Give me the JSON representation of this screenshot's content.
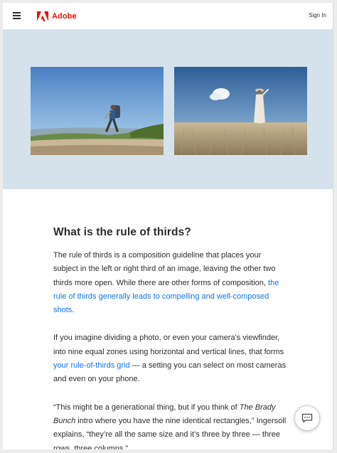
{
  "header": {
    "brand": "Adobe",
    "brand_color": "#eb1000",
    "menu_icon": "hamburger-menu-icon",
    "signin_label": "Sign In"
  },
  "hero": {
    "background": "#d5e2ec",
    "images": [
      {
        "name": "hiker-on-trail-photo"
      },
      {
        "name": "person-in-grass-field-photo"
      }
    ]
  },
  "article": {
    "heading": "What is the rule of thirds?",
    "p1_text": "The rule of thirds is a composition guideline that places your subject in the left or right third of an image, leaving the other two thirds more open. While there are other forms of composition, ",
    "p1_link": "the rule of thirds generally leads to compelling and well-composed shots",
    "p1_end": ".",
    "p2_text": "If you imagine dividing a photo, or even your camera's viewfinder, into nine equal zones using horizontal and vertical lines, that forms ",
    "p2_link": "your rule-of-thirds grid",
    "p2_end": " — a setting you can select on most cameras and even on your phone.",
    "p3_start": "“This might be a generational thing, but if you think of ",
    "p3_em": "The Brady Bunch",
    "p3_end": " intro where you have the nine identical rectangles,” Ingersoll explains, “they’re all the same size and it’s three by three — three rows, three columns.”",
    "link_color": "#1473e6"
  },
  "chat": {
    "icon": "chat-bubble-icon"
  }
}
